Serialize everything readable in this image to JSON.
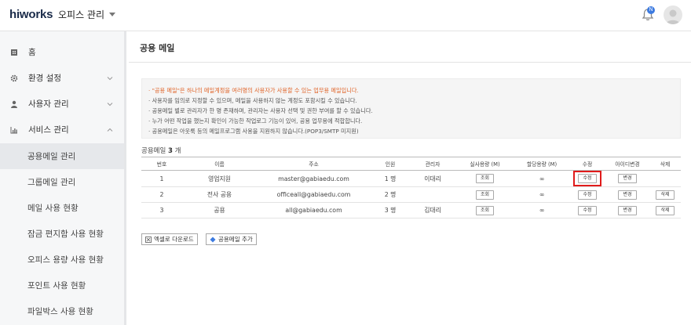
{
  "header": {
    "logo": "hiworks",
    "menu_label": "오피스 관리",
    "notification_badge": "N"
  },
  "sidebar": {
    "items": [
      {
        "label": "홈",
        "icon": "home-icon"
      },
      {
        "label": "환경 설정",
        "icon": "gear-icon"
      },
      {
        "label": "사용자 관리",
        "icon": "user-icon"
      },
      {
        "label": "서비스 관리",
        "icon": "chart-icon"
      }
    ],
    "subitems": [
      {
        "label": "공용메일 관리"
      },
      {
        "label": "그룹메일 관리"
      },
      {
        "label": "메일 사용 현황"
      },
      {
        "label": "잠금 편지함 사용 현황"
      },
      {
        "label": "오피스 용량 사용 현황"
      },
      {
        "label": "포인트 사용 현황"
      },
      {
        "label": "파일박스 사용 현황"
      }
    ]
  },
  "main": {
    "title": "공용 메일",
    "info_lines": [
      "· \"공용 메일\"은 하나의 메일계정을 여러명의 사용자가 사용할 수 있는 업무용 메일입니다.",
      "· 사용자를 임의로 지정할 수 있으며, 메일을 사용하지 않는 계정도 포함시킬 수 있습니다.",
      "· 공용메일 별로 관리자가 한 명 존재하며, 관리자는 사용자 선택 및 권한 부여를 할 수 있습니다.",
      "· 누가 어떤 작업을 했는지 확인이 가능한 작업로그 기능이 있어, 공용 업무용에 적합합니다.",
      "· 공용메일은 아웃룩 등의 메일프로그램 사용을 지원하지 않습니다.(POP3/SMTP 미지원)"
    ],
    "count_prefix": "공용메일",
    "count_value": "3",
    "count_suffix": "개",
    "columns": [
      "번호",
      "이름",
      "주소",
      "인원",
      "관리자",
      "실사용량 (M)",
      "할당용량 (M)",
      "수정",
      "아이디변경",
      "삭제"
    ],
    "rows": [
      {
        "no": "1",
        "name": "영업지원",
        "address": "master@gabiaedu.com",
        "members": "1 명",
        "admin": "이대리",
        "usage_btn": "조회",
        "quota": "∞",
        "edit_btn": "수정",
        "id_btn": "변경",
        "delete_btn": ""
      },
      {
        "no": "2",
        "name": "전사 공용",
        "address": "officeall@gabiaedu.com",
        "members": "2 명",
        "admin": "",
        "usage_btn": "조회",
        "quota": "∞",
        "edit_btn": "수정",
        "id_btn": "변경",
        "delete_btn": "삭제"
      },
      {
        "no": "3",
        "name": "공용",
        "address": "all@gabiaedu.com",
        "members": "3 명",
        "admin": "김대리",
        "usage_btn": "조회",
        "quota": "∞",
        "edit_btn": "수정",
        "id_btn": "변경",
        "delete_btn": "삭제"
      }
    ],
    "excel_button": "엑셀로 다운로드",
    "add_button": "공용메일 추가"
  },
  "colors": {
    "accent": "#3d7be0",
    "highlight": "#e01b1b",
    "info_orange": "#e0652a"
  }
}
